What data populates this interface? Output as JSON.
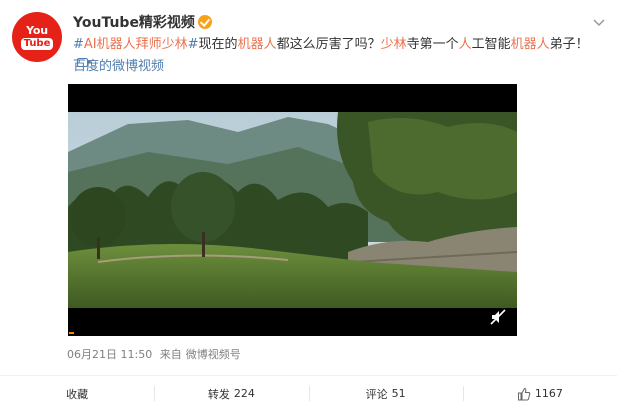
{
  "header": {
    "avatar_line1": "You",
    "avatar_line2": "Tube",
    "username": "YouTube精彩视频"
  },
  "post": {
    "segments": [
      {
        "text": "#",
        "cls": "topic"
      },
      {
        "text": "AI机器人拜师少林",
        "cls": "hl"
      },
      {
        "text": "#",
        "cls": "topic"
      },
      {
        "text": "现在的",
        "cls": ""
      },
      {
        "text": "机器人",
        "cls": "hl"
      },
      {
        "text": "都这么厉害了吗？",
        "cls": ""
      },
      {
        "text": "少林",
        "cls": "hl"
      },
      {
        "text": "寺第一个",
        "cls": ""
      },
      {
        "text": "人",
        "cls": "hl"
      },
      {
        "text": "工智能",
        "cls": ""
      },
      {
        "text": "机器人",
        "cls": "hl"
      },
      {
        "text": "弟子！",
        "cls": ""
      }
    ],
    "source_link": "百度的微博视频"
  },
  "meta": {
    "time": "06月21日 11:50",
    "from_label": "来自",
    "from_source": "微博视频号"
  },
  "actions": {
    "favorite": "收藏",
    "repost": "转发",
    "repost_count": "224",
    "comment": "评论",
    "comment_count": "51",
    "like_count": "1167"
  },
  "colors": {
    "highlight": "#eb7350",
    "link": "#507daf",
    "brand": "#e62117",
    "verified": "#f7a21b"
  }
}
